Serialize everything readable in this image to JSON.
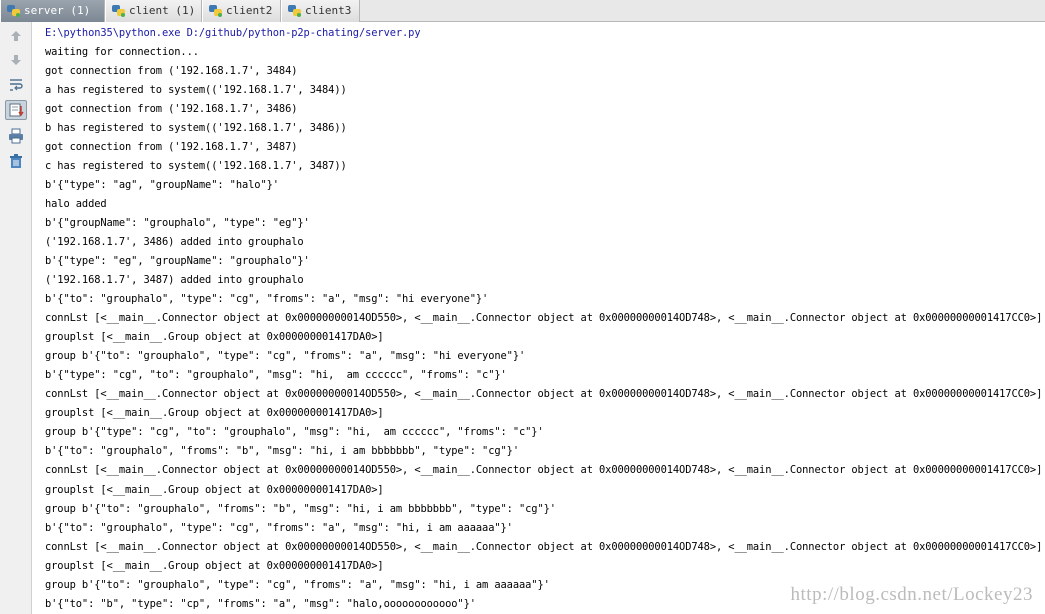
{
  "tabs": [
    {
      "label": "server (1)",
      "active": true
    },
    {
      "label": "client (1)",
      "active": false
    },
    {
      "label": "client2",
      "active": false
    },
    {
      "label": "client3",
      "active": false
    }
  ],
  "toolbar": {
    "icons": [
      "arrow-up-icon",
      "arrow-down-icon",
      "soft-wrap-icon",
      "scroll-to-end-icon",
      "print-icon",
      "trash-icon"
    ]
  },
  "console": {
    "command": "E:\\python35\\python.exe D:/github/python-p2p-chating/server.py",
    "lines": [
      "waiting for connection...",
      "got connection from ('192.168.1.7', 3484)",
      "a has registered to system(('192.168.1.7', 3484))",
      "got connection from ('192.168.1.7', 3486)",
      "b has registered to system(('192.168.1.7', 3486))",
      "got connection from ('192.168.1.7', 3487)",
      "c has registered to system(('192.168.1.7', 3487))",
      "b'{\"type\": \"ag\", \"groupName\": \"halo\"}'",
      "halo added",
      "b'{\"groupName\": \"grouphalo\", \"type\": \"eg\"}'",
      "('192.168.1.7', 3486) added into grouphalo",
      "b'{\"type\": \"eg\", \"groupName\": \"grouphalo\"}'",
      "('192.168.1.7', 3487) added into grouphalo",
      "b'{\"to\": \"grouphalo\", \"type\": \"cg\", \"froms\": \"a\", \"msg\": \"hi everyone\"}'",
      "connLst [<__main__.Connector object at 0x00000000014OD550>, <__main__.Connector object at 0x00000000014OD748>, <__main__.Connector object at 0x00000000001417CC0>]",
      "grouplst [<__main__.Group object at 0x000000001417DA0>]",
      "group b'{\"to\": \"grouphalo\", \"type\": \"cg\", \"froms\": \"a\", \"msg\": \"hi everyone\"}'",
      "b'{\"type\": \"cg\", \"to\": \"grouphalo\", \"msg\": \"hi,  am cccccc\", \"froms\": \"c\"}'",
      "connLst [<__main__.Connector object at 0x00000000014OD550>, <__main__.Connector object at 0x00000000014OD748>, <__main__.Connector object at 0x00000000001417CC0>]",
      "grouplst [<__main__.Group object at 0x000000001417DA0>]",
      "group b'{\"type\": \"cg\", \"to\": \"grouphalo\", \"msg\": \"hi,  am cccccc\", \"froms\": \"c\"}'",
      "b'{\"to\": \"grouphalo\", \"froms\": \"b\", \"msg\": \"hi, i am bbbbbbb\", \"type\": \"cg\"}'",
      "connLst [<__main__.Connector object at 0x00000000014OD550>, <__main__.Connector object at 0x00000000014OD748>, <__main__.Connector object at 0x00000000001417CC0>]",
      "grouplst [<__main__.Group object at 0x000000001417DA0>]",
      "group b'{\"to\": \"grouphalo\", \"froms\": \"b\", \"msg\": \"hi, i am bbbbbbb\", \"type\": \"cg\"}'",
      "b'{\"to\": \"grouphalo\", \"type\": \"cg\", \"froms\": \"a\", \"msg\": \"hi, i am aaaaaa\"}'",
      "connLst [<__main__.Connector object at 0x00000000014OD550>, <__main__.Connector object at 0x00000000014OD748>, <__main__.Connector object at 0x00000000001417CC0>]",
      "grouplst [<__main__.Group object at 0x000000001417DA0>]",
      "group b'{\"to\": \"grouphalo\", \"type\": \"cg\", \"froms\": \"a\", \"msg\": \"hi, i am aaaaaa\"}'",
      "b'{\"to\": \"b\", \"type\": \"cp\", \"froms\": \"a\", \"msg\": \"halo,oooooooooooo\"}'"
    ]
  },
  "watermark": "http://blog.csdn.net/Lockey23",
  "colors": {
    "command_text": "#1a1aa6",
    "output_text": "#000000",
    "active_tab": "#7c8894"
  }
}
